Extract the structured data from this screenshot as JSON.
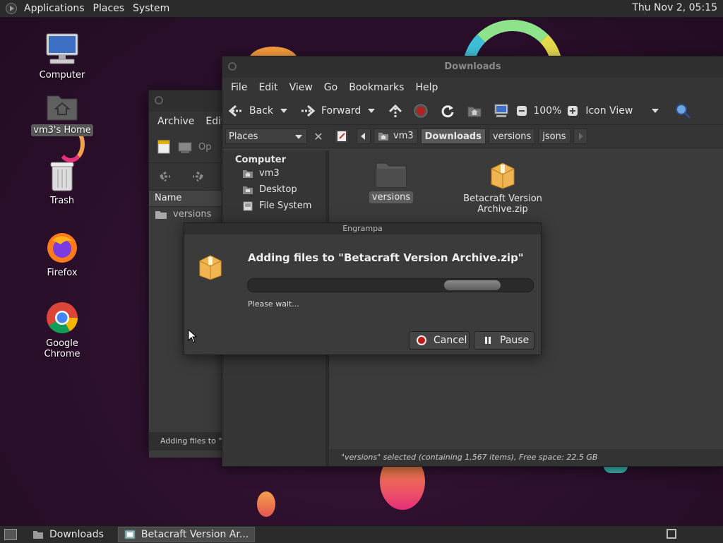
{
  "top_panel": {
    "menus": [
      "Applications",
      "Places",
      "System"
    ],
    "clock": "Thu Nov  2, 05:15"
  },
  "desktop": {
    "icons": [
      {
        "label": "Computer",
        "icon": "computer-icon"
      },
      {
        "label": "vm3's Home",
        "icon": "home-folder-icon",
        "selected": true
      },
      {
        "label": "Trash",
        "icon": "trash-icon"
      },
      {
        "label": "Firefox",
        "icon": "firefox-icon"
      },
      {
        "label": "Google Chrome",
        "icon": "chrome-icon"
      }
    ]
  },
  "archive_window": {
    "menus": [
      "Archive",
      "Edit"
    ],
    "toolbar_open_label": "Op",
    "column_name": "Name",
    "row_item": "versions",
    "status": "Adding files to \"Be"
  },
  "downloads_window": {
    "title": "Downloads",
    "menus": [
      "File",
      "Edit",
      "View",
      "Go",
      "Bookmarks",
      "Help"
    ],
    "toolbar": {
      "back": "Back",
      "forward": "Forward",
      "zoom": "100%",
      "view_mode": "Icon View"
    },
    "places_combo": "Places",
    "breadcrumbs": [
      "vm3",
      "Downloads",
      "versions",
      "jsons"
    ],
    "active_crumb": "Downloads",
    "sidebar": {
      "heading": "Computer",
      "items": [
        "vm3",
        "Desktop",
        "File System"
      ]
    },
    "files": [
      {
        "name": "versions",
        "type": "folder",
        "selected": true
      },
      {
        "name": "Betacraft Version Archive.zip",
        "type": "archive"
      }
    ],
    "status": "\"versions\" selected (containing 1,567 items), Free space: 22.5 GB"
  },
  "dialog": {
    "title": "Engrampa",
    "heading": "Adding files to \"Betacraft Version Archive.zip\"",
    "status": "Please wait...",
    "cancel": "Cancel",
    "pause": "Pause"
  },
  "taskbar": {
    "tasks": [
      {
        "label": "Downloads",
        "active": false
      },
      {
        "label": "Betacraft Version Ar...",
        "active": true
      }
    ]
  },
  "colors": {
    "panel": "#2b2b2b",
    "window": "#3b3b3b",
    "desktop": "#2a0f2a",
    "stop_red": "#c31818"
  }
}
